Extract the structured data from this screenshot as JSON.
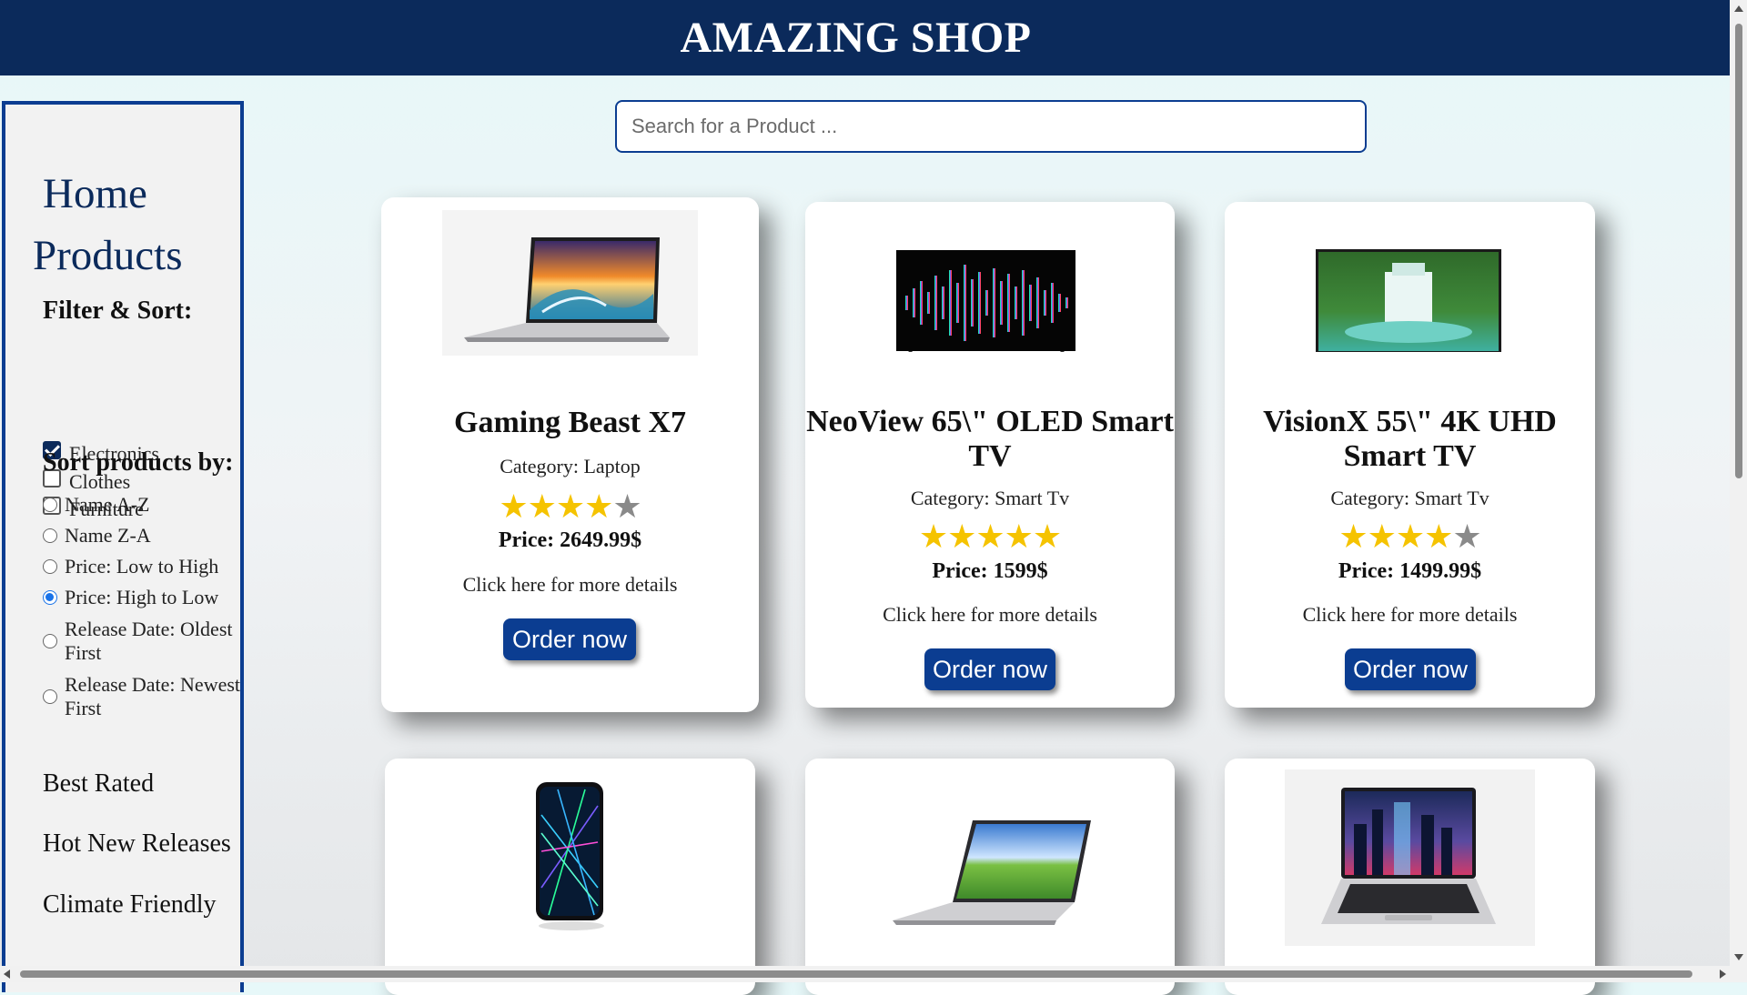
{
  "header": {
    "title": "AMAZING SHOP"
  },
  "sidebar": {
    "nav": {
      "home": "Home",
      "products": "Products"
    },
    "filter_title": "Filter & Sort:",
    "filters": [
      {
        "label": "Electronics",
        "checked": true
      },
      {
        "label": "Clothes",
        "checked": false
      },
      {
        "label": "Furniture",
        "checked": false
      }
    ],
    "sort_title": "Sort products by:",
    "sort_options": [
      {
        "label": "Name A-Z",
        "selected": false
      },
      {
        "label": "Name Z-A",
        "selected": false
      },
      {
        "label": "Price: Low to High",
        "selected": false
      },
      {
        "label": "Price: High to Low",
        "selected": true
      },
      {
        "label": "Release Date: Oldest First",
        "selected": false
      },
      {
        "label": "Release Date: Newest First",
        "selected": false
      }
    ],
    "links": {
      "best_rated": "Best Rated",
      "hot_new": "Hot New Releases",
      "climate": "Climate Friendly"
    }
  },
  "search": {
    "placeholder": "Search for a Product ...",
    "value": ""
  },
  "products": [
    {
      "name": "Gaming Beast X7",
      "category": "Category: Laptop",
      "rating": 4,
      "price": "Price: 2649.99$",
      "details": "Click here for more details",
      "order": "Order now",
      "image": "laptop-ocean-wave"
    },
    {
      "name": "NeoView 65\\\" OLED Smart TV",
      "category": "Category: Smart Tv",
      "rating": 5,
      "price": "Price: 1599$",
      "details": "Click here for more details",
      "order": "Order now",
      "image": "tv-sound-wave"
    },
    {
      "name": "VisionX 55\\\" 4K UHD Smart TV",
      "category": "Category: Smart Tv",
      "rating": 4,
      "price": "Price: 1499.99$",
      "details": "Click here for more details",
      "order": "Order now",
      "image": "tv-waterfall"
    },
    {
      "image": "phone-neon-lines"
    },
    {
      "image": "laptop-green-hills"
    },
    {
      "image": "laptop-city-night"
    }
  ],
  "colors": {
    "header": "#0b2a5b",
    "accent": "#0b3d91",
    "star": "#f5c300"
  }
}
